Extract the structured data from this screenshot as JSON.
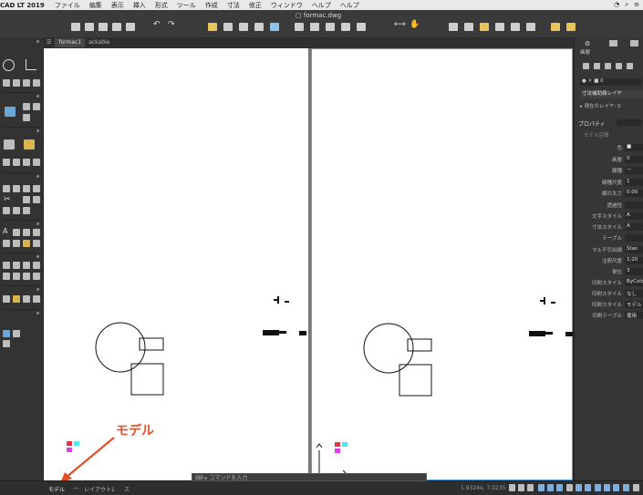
{
  "menubar": {
    "app_name": "CAD LT 2019",
    "items": [
      "ファイル",
      "編集",
      "表示",
      "挿入",
      "形式",
      "ツール",
      "作成",
      "寸法",
      "修正",
      "ウィンドウ",
      "ヘルプ",
      "ヘルプ"
    ]
  },
  "document": {
    "file_title": "formac.dwg"
  },
  "tabs": [
    {
      "label": "formac1",
      "active": true
    },
    {
      "label": "ackable",
      "active": false
    }
  ],
  "right_panel": {
    "layer_name": "寸法補助線レイヤ",
    "layer_state": "現在のレイヤ: 0",
    "properties_header": "プロパティ",
    "properties_sub": "モデル空間",
    "rows": [
      {
        "label": "色",
        "value": "■"
      },
      {
        "label": "画層",
        "value": "0"
      },
      {
        "label": "線種",
        "value": "—"
      },
      {
        "label": "線種尺度",
        "value": "1"
      },
      {
        "label": "線の太さ",
        "value": "0.00"
      },
      {
        "label": "透過性",
        "value": ""
      },
      {
        "label": "文字スタイル",
        "value": "A"
      },
      {
        "label": "寸法スタイル",
        "value": "A"
      },
      {
        "label": "テーブル",
        "value": ""
      },
      {
        "label": "マルチ引出線",
        "value": "Stan"
      },
      {
        "label": "注釈尺度",
        "value": "1:20"
      },
      {
        "label": "単位",
        "value": "3"
      },
      {
        "label": "印刷スタイル",
        "value": "ByColor"
      },
      {
        "label": "印刷スタイル",
        "value": "なし"
      },
      {
        "label": "印刷スタイル",
        "value": "モデル"
      },
      {
        "label": "印刷テーブル",
        "value": "使用"
      }
    ]
  },
  "statusbar": {
    "tabs": [
      "モデル",
      "レイアウト1",
      "ス"
    ],
    "command_placeholder": "コマンドを入力",
    "coords": "1.9324e, 7.0235"
  },
  "annotation": {
    "label": "モデル",
    "color": "#e0502b"
  },
  "colors": {
    "accent": "#4aa3df",
    "annotation": "#e0502b",
    "marker_red": "#e8334a",
    "marker_cyan": "#4de8f0",
    "marker_magenta": "#e23fe8"
  }
}
